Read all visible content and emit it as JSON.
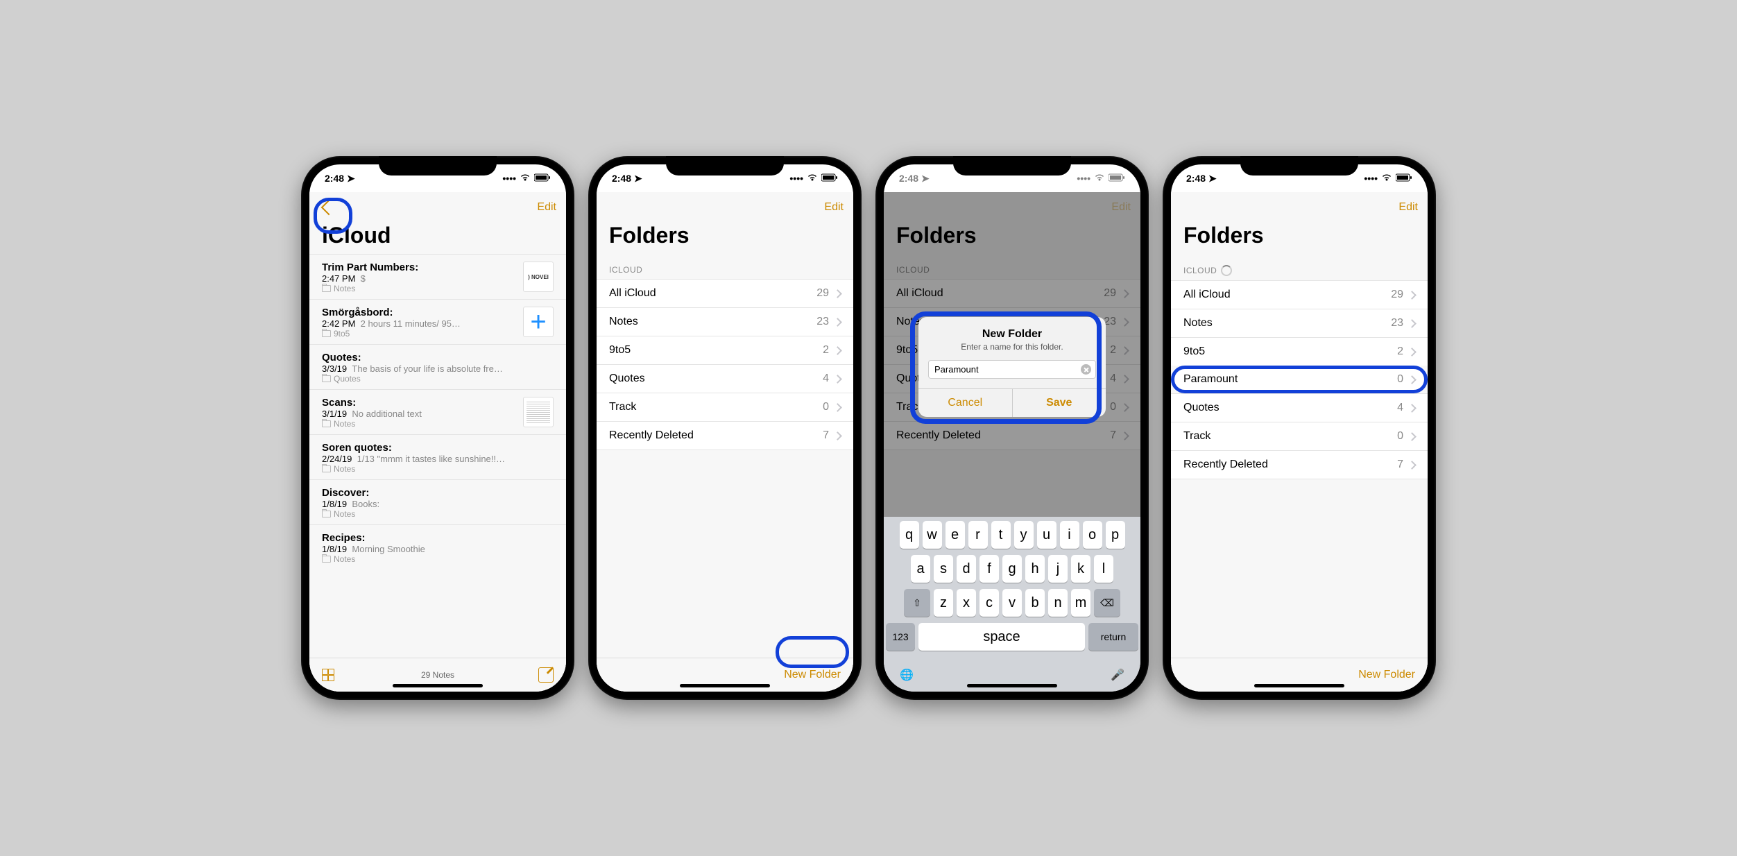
{
  "status_time": "2:48",
  "phone1": {
    "title": "iCloud",
    "edit": "Edit",
    "notes": [
      {
        "title": "Trim Part Numbers:",
        "time": "2:47 PM",
        "preview": "$",
        "folder": "Notes",
        "thumb": "novel"
      },
      {
        "title": "Smörgåsbord:",
        "time": "2:42 PM",
        "preview": "2 hours 11 minutes/ 95…",
        "folder": "9to5",
        "thumb": "plus"
      },
      {
        "title": "Quotes:",
        "time": "3/3/19",
        "preview": "The basis of your life is absolute fre…",
        "folder": "Quotes"
      },
      {
        "title": "Scans:",
        "time": "3/1/19",
        "preview": "No additional text",
        "folder": "Notes",
        "thumb": "doc"
      },
      {
        "title": "Soren quotes:",
        "time": "2/24/19",
        "preview": "1/13 \"mmm it tastes like sunshine!!…",
        "folder": "Notes"
      },
      {
        "title": "Discover:",
        "time": "1/8/19",
        "preview": "Books:",
        "folder": "Notes"
      },
      {
        "title": "Recipes:",
        "time": "1/8/19",
        "preview": "Morning Smoothie",
        "folder": "Notes"
      }
    ],
    "footer_count": "29 Notes"
  },
  "phone2": {
    "title": "Folders",
    "edit": "Edit",
    "section": "ICLOUD",
    "folders": [
      {
        "name": "All iCloud",
        "count": 29
      },
      {
        "name": "Notes",
        "count": 23
      },
      {
        "name": "9to5",
        "count": 2
      },
      {
        "name": "Quotes",
        "count": 4
      },
      {
        "name": "Track",
        "count": 0
      },
      {
        "name": "Recently Deleted",
        "count": 7
      }
    ],
    "new_folder": "New Folder"
  },
  "phone3": {
    "title": "Folders",
    "section": "ICLOUD",
    "folders": [
      {
        "name": "All iCloud",
        "count": 29
      },
      {
        "name": "Notes",
        "count": 23
      },
      {
        "name": "9to5",
        "count": 2
      },
      {
        "name": "Quotes",
        "count": 4
      },
      {
        "name": "Track",
        "count": 0
      },
      {
        "name": "Recently Deleted",
        "count": 7
      }
    ],
    "alert": {
      "title": "New Folder",
      "message": "Enter a name for this folder.",
      "input": "Paramount",
      "cancel": "Cancel",
      "save": "Save"
    },
    "keyboard": {
      "r1": [
        "q",
        "w",
        "e",
        "r",
        "t",
        "y",
        "u",
        "i",
        "o",
        "p"
      ],
      "r2": [
        "a",
        "s",
        "d",
        "f",
        "g",
        "h",
        "j",
        "k",
        "l"
      ],
      "r3": [
        "z",
        "x",
        "c",
        "v",
        "b",
        "n",
        "m"
      ],
      "num": "123",
      "space": "space",
      "return": "return"
    }
  },
  "phone4": {
    "title": "Folders",
    "edit": "Edit",
    "section": "ICLOUD",
    "folders": [
      {
        "name": "All iCloud",
        "count": 29
      },
      {
        "name": "Notes",
        "count": 23
      },
      {
        "name": "9to5",
        "count": 2
      },
      {
        "name": "Paramount",
        "count": 0,
        "highlight": true
      },
      {
        "name": "Quotes",
        "count": 4
      },
      {
        "name": "Track",
        "count": 0
      },
      {
        "name": "Recently Deleted",
        "count": 7
      }
    ],
    "new_folder": "New Folder"
  }
}
